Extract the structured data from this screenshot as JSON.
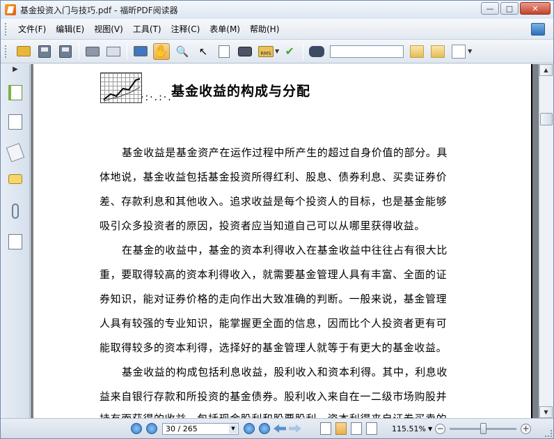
{
  "window": {
    "title": "基金投资入门与技巧.pdf - 福昕PDF阅读器",
    "minimize_label": "—",
    "maximize_label": "□",
    "close_label": "✕"
  },
  "menu": {
    "items": [
      "文件(F)",
      "编辑(E)",
      "视图(V)",
      "工具(T)",
      "注释(C)",
      "表单(M)",
      "帮助(H)"
    ]
  },
  "toolbar": {
    "icons": [
      "open-folder-icon",
      "save-icon",
      "save-as-icon",
      "print-icon",
      "scan-icon",
      "fullscreen-icon",
      "hand-tool-icon",
      "zoom-tool-icon",
      "select-arrow-icon",
      "text-select-icon",
      "snapshot-icon",
      "rms-lock-icon",
      "sign-icon",
      "find-icon",
      "find-previous-icon",
      "find-next-icon",
      "highlight-icon"
    ],
    "rms_label": "RMS",
    "search_value": ""
  },
  "document": {
    "heading": "基金收益的构成与分配",
    "lines": [
      "基金收益是基金资产在运作过程中所产生的超过自身价值的部分。具",
      "体地说，基金收益包括基金投资所得红利、股息、债券利息、买卖证券价",
      "差、存款利息和其他收入。追求收益是每个投资人的目标，也是基金能够",
      "吸引众多投资者的原因，投资者应当知道自己可以从哪里获得收益。",
      "在基金的收益中，基金的资本利得收入在基金收益中往往占有很大比",
      "重，要取得较高的资本利得收入，就需要基金管理人具有丰富、全面的证",
      "券知识，能对证券价格的走向作出大致准确的判断。一般来说，基金管理",
      "人具有较强的专业知识，能掌握更全面的信息，因而比个人投资者更有可",
      "能取得较多的资本利得，选择好的基金管理人就等于有更大的基金收益。",
      "基金收益的构成包括利息收益，股利收入和资本利得。其中，利息收",
      "益来自银行存款和所投资的基金债券。股利收入来自在一二级市场购股并",
      "持有而获得的收益，包括现金股利和股票股利。资本利得来自证券买卖的"
    ]
  },
  "status": {
    "page_display": "30 / 265",
    "current_page": 30,
    "total_pages": 265,
    "zoom": "115.51%",
    "zoom_out_label": "−",
    "zoom_in_label": "+"
  },
  "side_panel": {
    "toggle": "▶",
    "icons": [
      "bookmarks-icon",
      "pages-icon",
      "layers-icon",
      "comments-icon",
      "attachments-icon",
      "signatures-icon"
    ]
  }
}
